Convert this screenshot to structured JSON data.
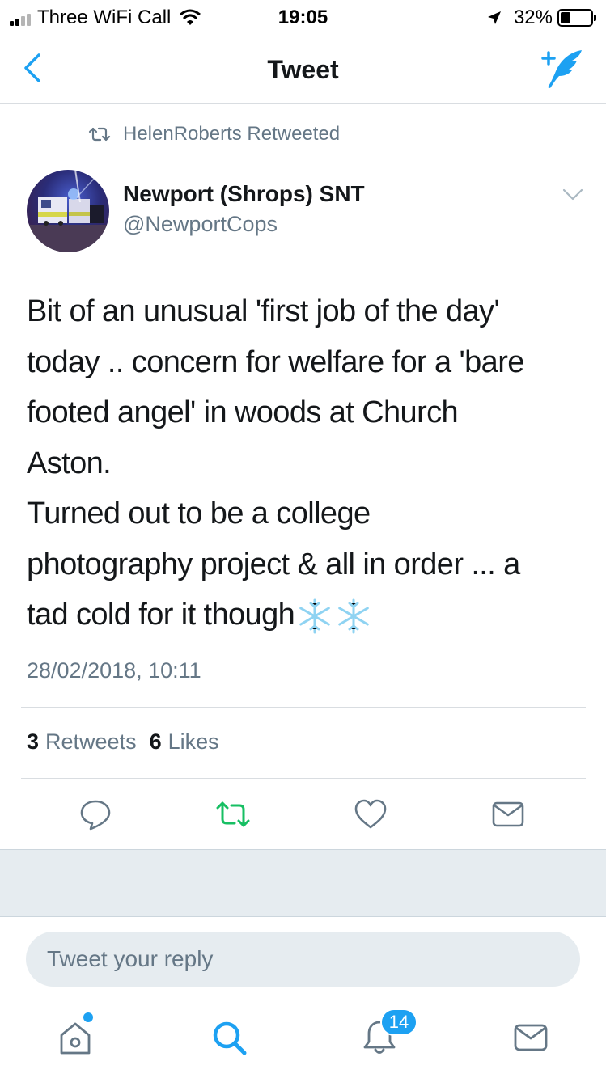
{
  "status_bar": {
    "carrier": "Three WiFi Call",
    "time": "19:05",
    "battery_percent": "32%",
    "battery_level": 0.32,
    "signal_icon": "signal-bars-icon",
    "wifi_icon": "wifi-icon",
    "location_icon": "location-arrow-icon"
  },
  "nav": {
    "title": "Tweet",
    "back_icon": "chevron-left-icon",
    "compose_icon": "compose-tweet-icon",
    "accent_color": "#1da1f2"
  },
  "tweet": {
    "retweet_context": "HelenRoberts Retweeted",
    "author_name": "Newport (Shrops) SNT",
    "author_handle": "@NewportCops",
    "text_lines": [
      "Bit of an unusual 'first job of the day'",
      "today .. concern for welfare for a 'bare",
      "footed angel' in woods at Church",
      "Aston.",
      "Turned out to be a college",
      "photography project & all in order ... a",
      "tad cold for it though"
    ],
    "emoji": "snowflake-icon",
    "timestamp": "28/02/2018, 10:11",
    "retweets_count": "3",
    "retweets_label": "Retweets",
    "likes_count": "6",
    "likes_label": "Likes"
  },
  "actions": [
    "reply-icon",
    "retweet-icon",
    "like-icon",
    "direct-message-icon"
  ],
  "reply": {
    "placeholder": "Tweet your reply"
  },
  "tab_bar": {
    "items": [
      "home-icon",
      "search-icon",
      "notifications-icon",
      "messages-icon"
    ],
    "notifications_badge": "14"
  }
}
